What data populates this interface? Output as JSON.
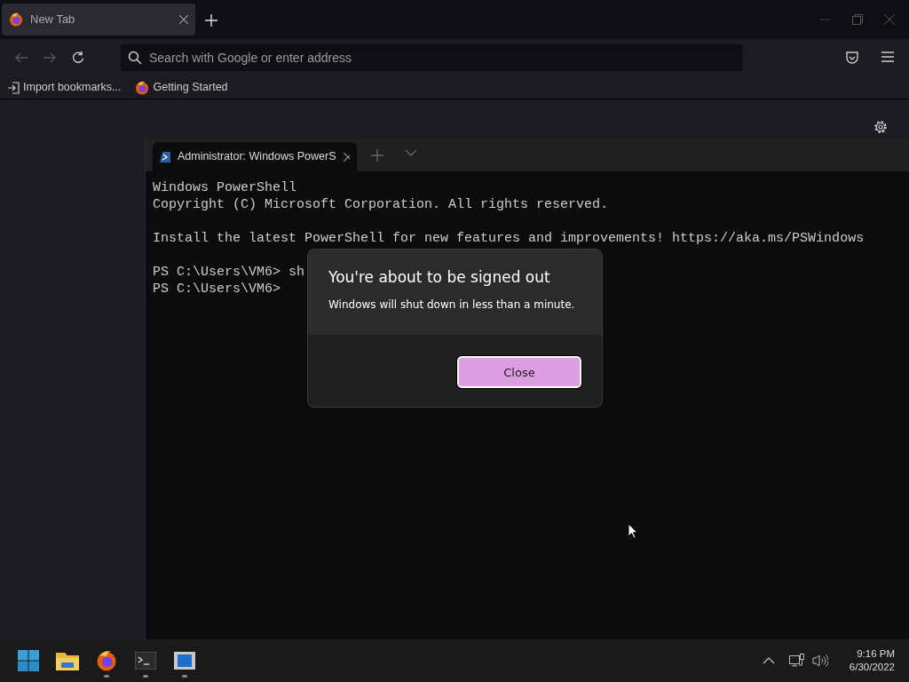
{
  "browser": {
    "tabs": [
      {
        "label": "New Tab",
        "selected": true
      }
    ],
    "address": {
      "placeholder": "Search with Google or enter address"
    },
    "bookmarks": [
      "Import bookmarks...",
      "Getting Started"
    ]
  },
  "terminal": {
    "tabs": [
      {
        "label": "Administrator: Windows PowerS",
        "selected": true
      }
    ],
    "blocks": [
      [
        "Windows PowerShell",
        "Copyright (C) Microsoft Corporation. All rights reserved."
      ],
      [
        "Install the latest PowerShell for new features and improvements! https://aka.ms/PSWindows"
      ],
      [
        "PS C:\\Users\\VM6> sh",
        "PS C:\\Users\\VM6>"
      ]
    ]
  },
  "dialog": {
    "title": "You're about to be signed out",
    "message": "Windows will shut down in less than a minute.",
    "button": "Close"
  },
  "taskbar": {
    "apps": [
      {
        "kind": "start",
        "running": false
      },
      {
        "kind": "files",
        "running": false
      },
      {
        "kind": "browser",
        "running": true
      },
      {
        "kind": "terminal",
        "running": true
      },
      {
        "kind": "window",
        "running": true
      }
    ],
    "time": "9:16 PM",
    "date": "6/30/2022"
  }
}
